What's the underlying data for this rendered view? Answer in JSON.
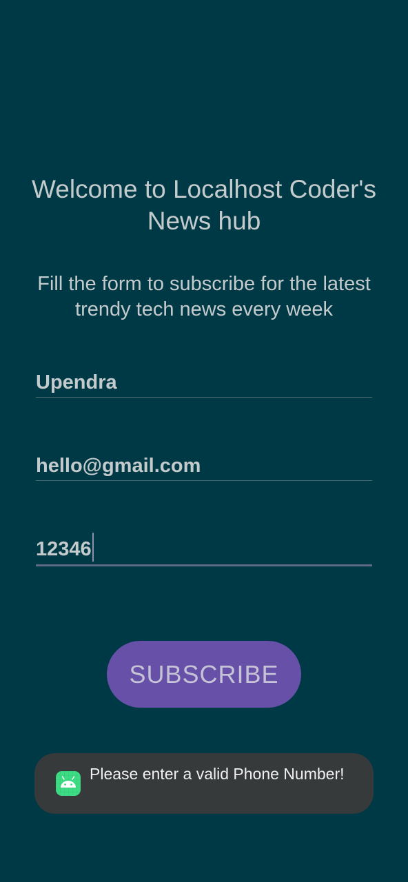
{
  "header": {
    "title": "Welcome to Localhost Coder's News hub",
    "subtitle": "Fill the form to subscribe for the latest trendy tech news every week"
  },
  "form": {
    "name_value": "Upendra",
    "email_value": "hello@gmail.com",
    "phone_value": "12346",
    "subscribe_label": "SUBSCRIBE"
  },
  "toast": {
    "message": "Please enter a valid Phone Number!",
    "icon": "android-app-icon"
  },
  "colors": {
    "background": "#003946",
    "button": "#6650a8",
    "toast_background": "#363a3b",
    "android_green": "#3ddc84"
  }
}
